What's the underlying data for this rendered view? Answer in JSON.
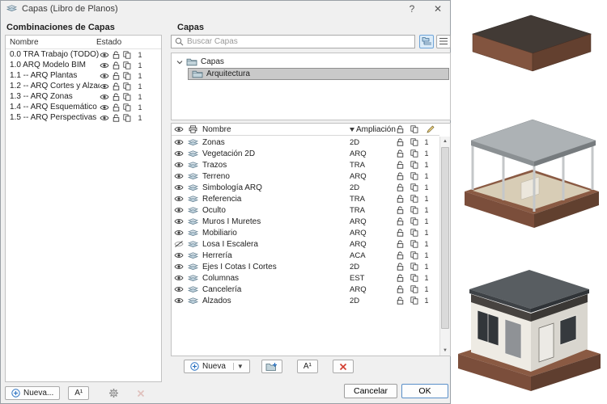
{
  "window": {
    "title": "Capas (Libro de Planos)",
    "help": "?",
    "close": "✕"
  },
  "combinations_panel": {
    "title": "Combinaciones de Capas",
    "col_name": "Nombre",
    "col_state": "Estado",
    "rows": [
      {
        "name": "0.0 TRA Trabajo (TODO)",
        "count": "1"
      },
      {
        "name": "1.0 ARQ Modelo BIM",
        "count": "1"
      },
      {
        "name": "1.1 -- ARQ Plantas",
        "count": "1"
      },
      {
        "name": "1.2 -- ARQ Cortes y Alzados",
        "count": "1"
      },
      {
        "name": "1.3 -- ARQ Zonas",
        "count": "1"
      },
      {
        "name": "1.4 -- ARQ Esquemático",
        "count": "1"
      },
      {
        "name": "1.5 -- ARQ Perspectivas",
        "count": "1"
      }
    ],
    "new_label": "Nueva...",
    "rename_label": "A¹"
  },
  "layers_panel": {
    "title": "Capas",
    "search_placeholder": "Buscar Capas",
    "tree_root": "Capas",
    "tree_selected": "Arquitectura",
    "col_name": "Nombre",
    "col_extension": "Ampliación",
    "rows": [
      {
        "name": "Zonas",
        "ext": "2D",
        "visible": true,
        "count": "1"
      },
      {
        "name": "Vegetación 2D",
        "ext": "ARQ",
        "visible": true,
        "count": "1"
      },
      {
        "name": "Trazos",
        "ext": "TRA",
        "visible": true,
        "count": "1"
      },
      {
        "name": "Terreno",
        "ext": "ARQ",
        "visible": true,
        "count": "1"
      },
      {
        "name": "Simbología ARQ",
        "ext": "2D",
        "visible": true,
        "count": "1"
      },
      {
        "name": "Referencia",
        "ext": "TRA",
        "visible": true,
        "count": "1"
      },
      {
        "name": "Oculto",
        "ext": "TRA",
        "visible": true,
        "count": "1"
      },
      {
        "name": "Muros I Muretes",
        "ext": "ARQ",
        "visible": true,
        "count": "1"
      },
      {
        "name": "Mobiliario",
        "ext": "ARQ",
        "visible": true,
        "count": "1"
      },
      {
        "name": "Losa I Escalera",
        "ext": "ARQ",
        "visible": false,
        "count": "1"
      },
      {
        "name": "Herrería",
        "ext": "ACA",
        "visible": true,
        "count": "1"
      },
      {
        "name": "Ejes I Cotas I Cortes",
        "ext": "2D",
        "visible": true,
        "count": "1"
      },
      {
        "name": "Columnas",
        "ext": "EST",
        "visible": true,
        "count": "1"
      },
      {
        "name": "Cancelería",
        "ext": "ARQ",
        "visible": true,
        "count": "1"
      },
      {
        "name": "Alzados",
        "ext": "2D",
        "visible": true,
        "count": "1"
      }
    ],
    "new_label": "Nueva",
    "rename_label": "A¹"
  },
  "footer": {
    "cancel": "Cancelar",
    "ok": "OK"
  },
  "colors": {
    "accent": "#2a72c3",
    "selection": "#c9c9c9",
    "delete_red": "#d23b2e"
  }
}
